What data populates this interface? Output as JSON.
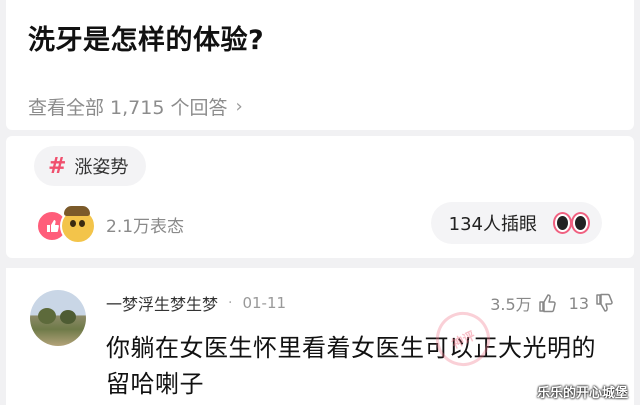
{
  "question": {
    "title": "洗牙是怎样的体验?",
    "view_all": "查看全部 1,715 个回答"
  },
  "topic": {
    "tag": "涨姿势"
  },
  "reactions": {
    "count": "2.1万表态"
  },
  "insert_eye": {
    "label": "134人插眼"
  },
  "comment": {
    "author": "一梦浮生梦生梦",
    "date": "01-11",
    "likes": "3.5万",
    "dislikes": "13",
    "text": "你躺在女医生怀里看着女医生可以正大光明的留哈喇子"
  },
  "watermark": {
    "stamp": "神评",
    "corner": "乐乐的开心城堡"
  },
  "icons": [
    "chevron-right-icon",
    "hashtag-icon",
    "like-emoji-icon",
    "laugh-emoji-icon",
    "eyes-icon",
    "thumb-up-icon",
    "thumb-down-icon"
  ]
}
